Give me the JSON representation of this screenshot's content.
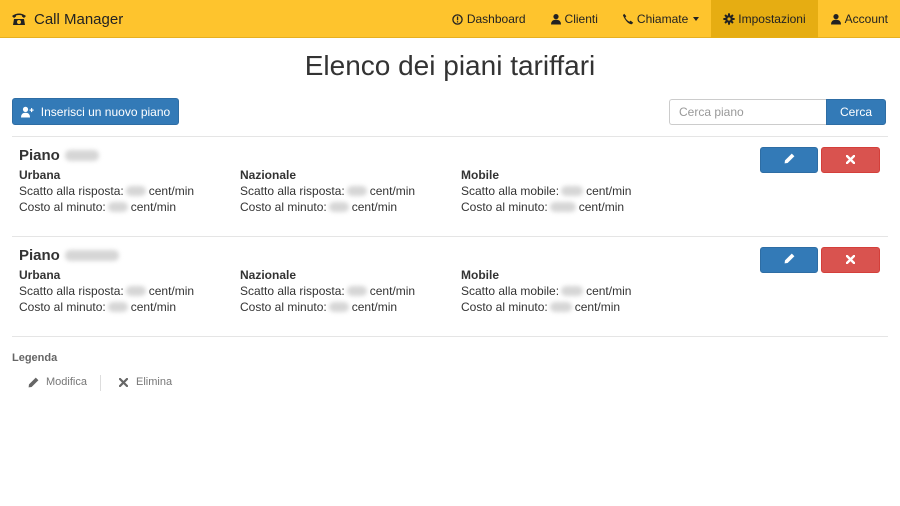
{
  "navbar": {
    "brand": "Call Manager",
    "items": [
      {
        "label": "Dashboard",
        "icon": "info-circle-icon"
      },
      {
        "label": "Clienti",
        "icon": "user-icon"
      },
      {
        "label": "Chiamate",
        "icon": "phone-icon",
        "dropdown": true
      },
      {
        "label": "Impostazioni",
        "icon": "gear-icon",
        "active": true
      },
      {
        "label": "Account",
        "icon": "user-icon"
      }
    ]
  },
  "page": {
    "title": "Elenco dei piani tariffari",
    "add_button": "Inserisci un nuovo piano",
    "search_placeholder": "Cerca piano",
    "search_button": "Cerca"
  },
  "plans": [
    {
      "title": "Piano",
      "urbana": {
        "heading": "Urbana",
        "line1_label": "Scatto alla risposta:",
        "line1_unit": "cent/min",
        "line2_label": "Costo al minuto:",
        "line2_unit": "cent/min"
      },
      "nazionale": {
        "heading": "Nazionale",
        "line1_label": "Scatto alla risposta:",
        "line1_unit": "cent/min",
        "line2_label": "Costo al minuto:",
        "line2_unit": "cent/min"
      },
      "mobile": {
        "heading": "Mobile",
        "line1_label": "Scatto alla mobile:",
        "line1_unit": "cent/min",
        "line2_label": "Costo al minuto:",
        "line2_unit": "cent/min"
      }
    },
    {
      "title": "Piano",
      "urbana": {
        "heading": "Urbana",
        "line1_label": "Scatto alla risposta:",
        "line1_unit": "cent/min",
        "line2_label": "Costo al minuto:",
        "line2_unit": "cent/min"
      },
      "nazionale": {
        "heading": "Nazionale",
        "line1_label": "Scatto alla risposta:",
        "line1_unit": "cent/min",
        "line2_label": "Costo al minuto:",
        "line2_unit": "cent/min"
      },
      "mobile": {
        "heading": "Mobile",
        "line1_label": "Scatto alla mobile:",
        "line1_unit": "cent/min",
        "line2_label": "Costo al minuto:",
        "line2_unit": "cent/min"
      }
    }
  ],
  "legend": {
    "title": "Legenda",
    "items": [
      {
        "label": "Modifica",
        "icon": "pencil-icon"
      },
      {
        "label": "Elimina",
        "icon": "close-icon"
      }
    ]
  },
  "colors": {
    "navbar": "#fec42d",
    "navbar_active": "#e6ad12",
    "primary": "#337ab7",
    "danger": "#d9534f"
  }
}
